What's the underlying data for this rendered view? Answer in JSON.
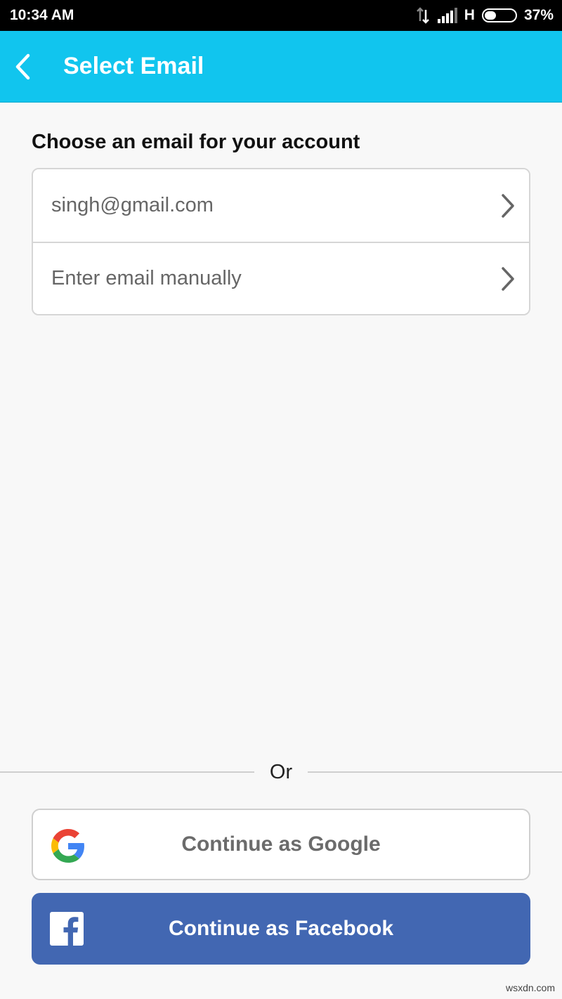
{
  "status_bar": {
    "time": "10:34 AM",
    "network": "H",
    "battery_text": "37%",
    "battery_level": 0.37
  },
  "app_bar": {
    "title": "Select Email",
    "accent_color": "#11c5ee",
    "back_icon": "chevron-left-icon"
  },
  "heading": "Choose an email for your account",
  "email_options": [
    {
      "label": "singh@gmail.com",
      "icon": "chevron-right-icon"
    },
    {
      "label": "Enter email manually",
      "icon": "chevron-right-icon"
    }
  ],
  "divider_text": "Or",
  "google_button": {
    "label": "Continue as Google",
    "icon": "google-icon"
  },
  "facebook_button": {
    "label": "Continue as Facebook",
    "icon": "facebook-icon",
    "color": "#4267b2"
  },
  "watermark": "wsxdn.com"
}
